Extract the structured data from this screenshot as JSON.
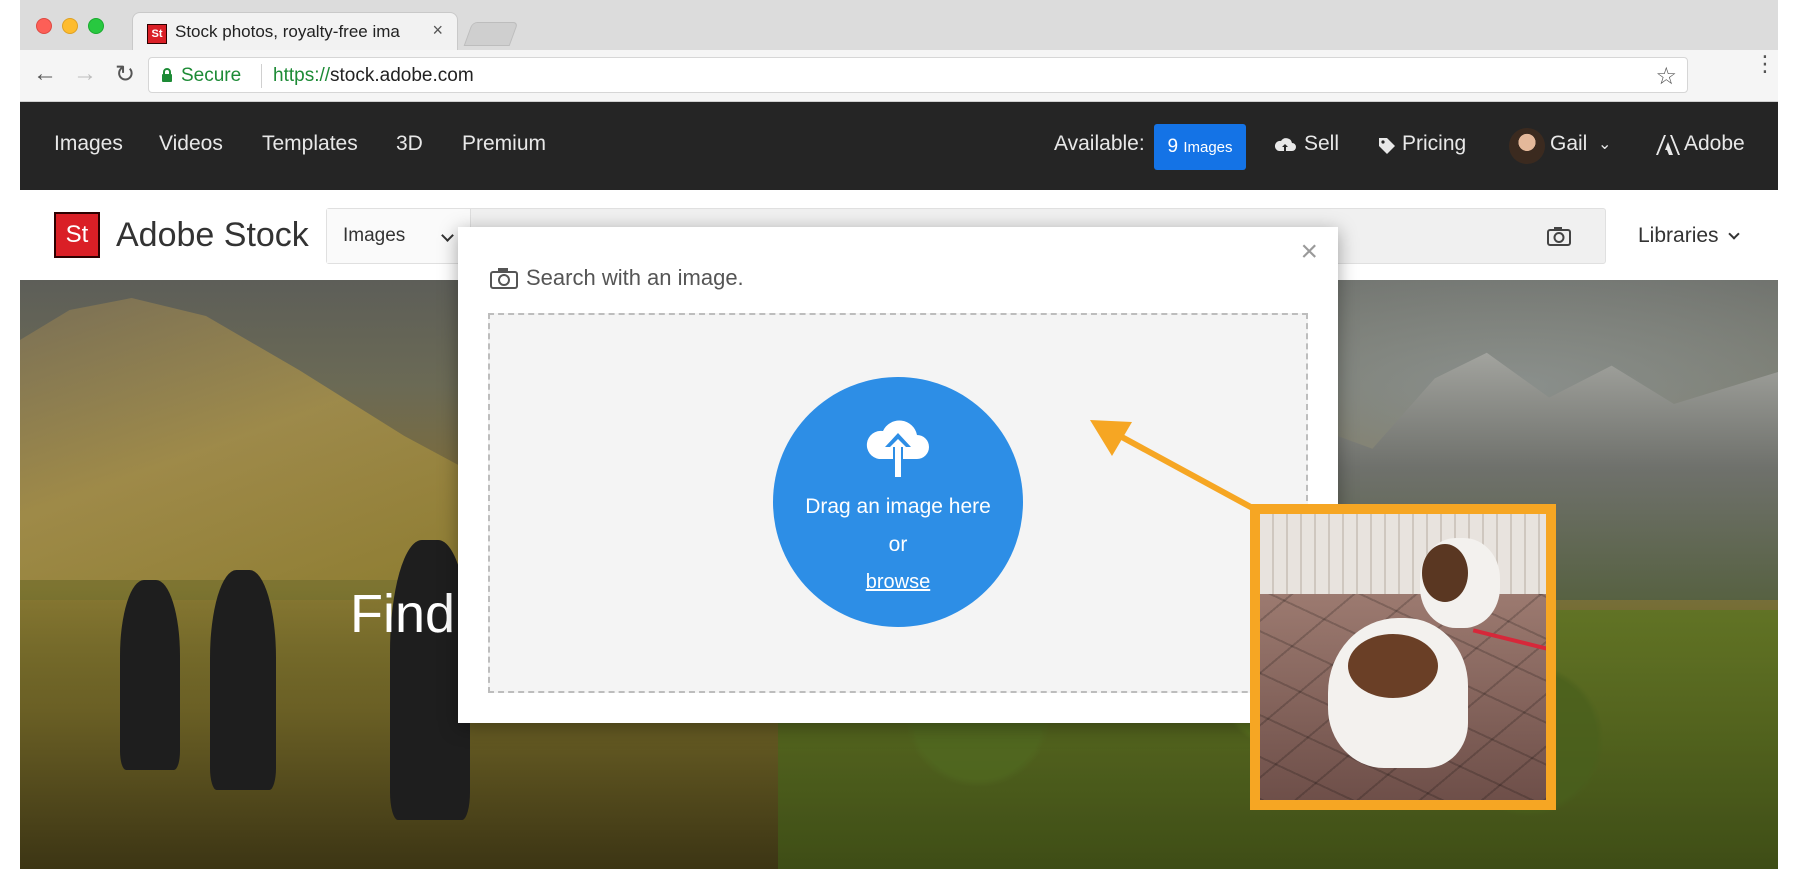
{
  "browser": {
    "tab_title": "Stock photos, royalty-free ima",
    "tab_close": "×",
    "secure_label": "Secure",
    "url_protocol": "https://",
    "url_host": "stock.adobe.com"
  },
  "topnav": {
    "items": [
      "Images",
      "Videos",
      "Templates",
      "3D",
      "Premium"
    ],
    "available_label": "Available:",
    "available_count": "9",
    "available_unit": "Images",
    "sell": "Sell",
    "pricing": "Pricing",
    "user": "Gail",
    "adobe": "Adobe"
  },
  "stockbar": {
    "logo_text": "St",
    "title": "Adobe Stock",
    "search_category": "Images",
    "libraries": "Libraries"
  },
  "hero": {
    "headline": "Find"
  },
  "modal": {
    "title": "Search with an image.",
    "close": "×",
    "drag_text": "Drag an image here",
    "or_text": "or",
    "browse": "browse"
  },
  "colors": {
    "accent_blue": "#1473e6",
    "upload_blue": "#2d8ee6",
    "annotation_orange": "#f6a623",
    "adobe_red": "#da1f26"
  }
}
